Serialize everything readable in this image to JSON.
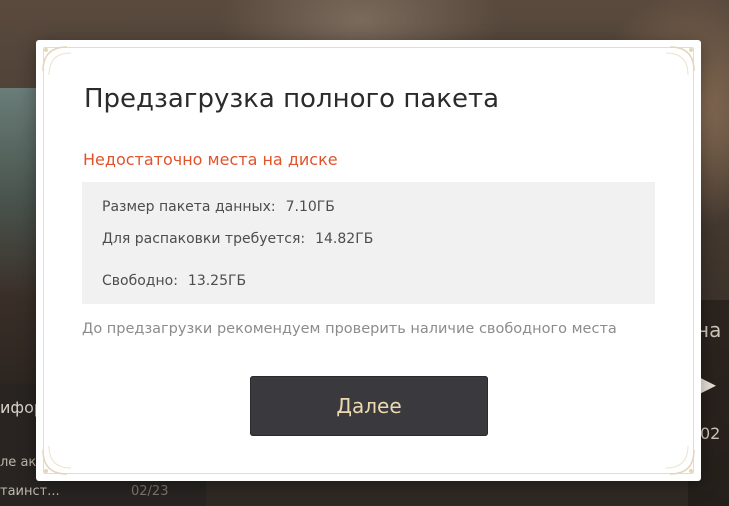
{
  "background": {
    "news_title_partial": "ифор",
    "news_item_1_partial": "ле ак",
    "news_item_2_partial": "таинст...",
    "news_item_2_date": "02/23",
    "right_text_1_partial": "на",
    "right_text_2_partial": "▸ 1",
    "right_text_3_partial": "02"
  },
  "dialog": {
    "title": "Предзагрузка полного пакета",
    "warning": "Недостаточно места на диске",
    "info": {
      "size_label": "Размер пакета данных:",
      "size_value": "7.10ГБ",
      "unpack_label": "Для распаковки требуется:",
      "unpack_value": "14.82ГБ",
      "free_label": "Свободно:",
      "free_value": "13.25ГБ"
    },
    "hint": "До предзагрузки рекомендуем проверить наличие свободного места",
    "next_button_label": "Далее"
  },
  "colors": {
    "warning": "#e0532b",
    "button_bg": "#3a3a3e",
    "button_text": "#ecd9b0",
    "frame_gold": "#e7dcc5"
  }
}
